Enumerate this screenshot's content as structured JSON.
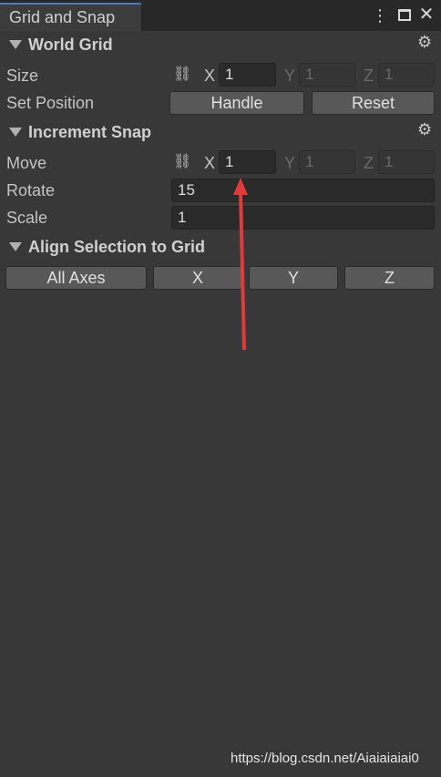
{
  "window": {
    "tab_title": "Grid and Snap",
    "menu_icon": "kebab-menu-icon",
    "maximize_icon": "maximize-icon",
    "close_icon": "close-icon"
  },
  "world_grid": {
    "title": "World Grid",
    "size": {
      "label": "Size",
      "x_label": "X",
      "x": "1",
      "y_label": "Y",
      "y": "1",
      "z_label": "Z",
      "z": "1"
    },
    "set_position": {
      "label": "Set Position",
      "handle": "Handle",
      "reset": "Reset"
    }
  },
  "increment_snap": {
    "title": "Increment Snap",
    "move": {
      "label": "Move",
      "x_label": "X",
      "x": "1",
      "y_label": "Y",
      "y": "1",
      "z_label": "Z",
      "z": "1"
    },
    "rotate": {
      "label": "Rotate",
      "value": "15"
    },
    "scale": {
      "label": "Scale",
      "value": "1"
    }
  },
  "align": {
    "title": "Align Selection to Grid",
    "buttons": [
      "All Axes",
      "X",
      "Y",
      "Z"
    ]
  },
  "annotation": {
    "color": "#e03a3a"
  },
  "watermark": "https://blog.csdn.net/Aiaiaiaiai0"
}
